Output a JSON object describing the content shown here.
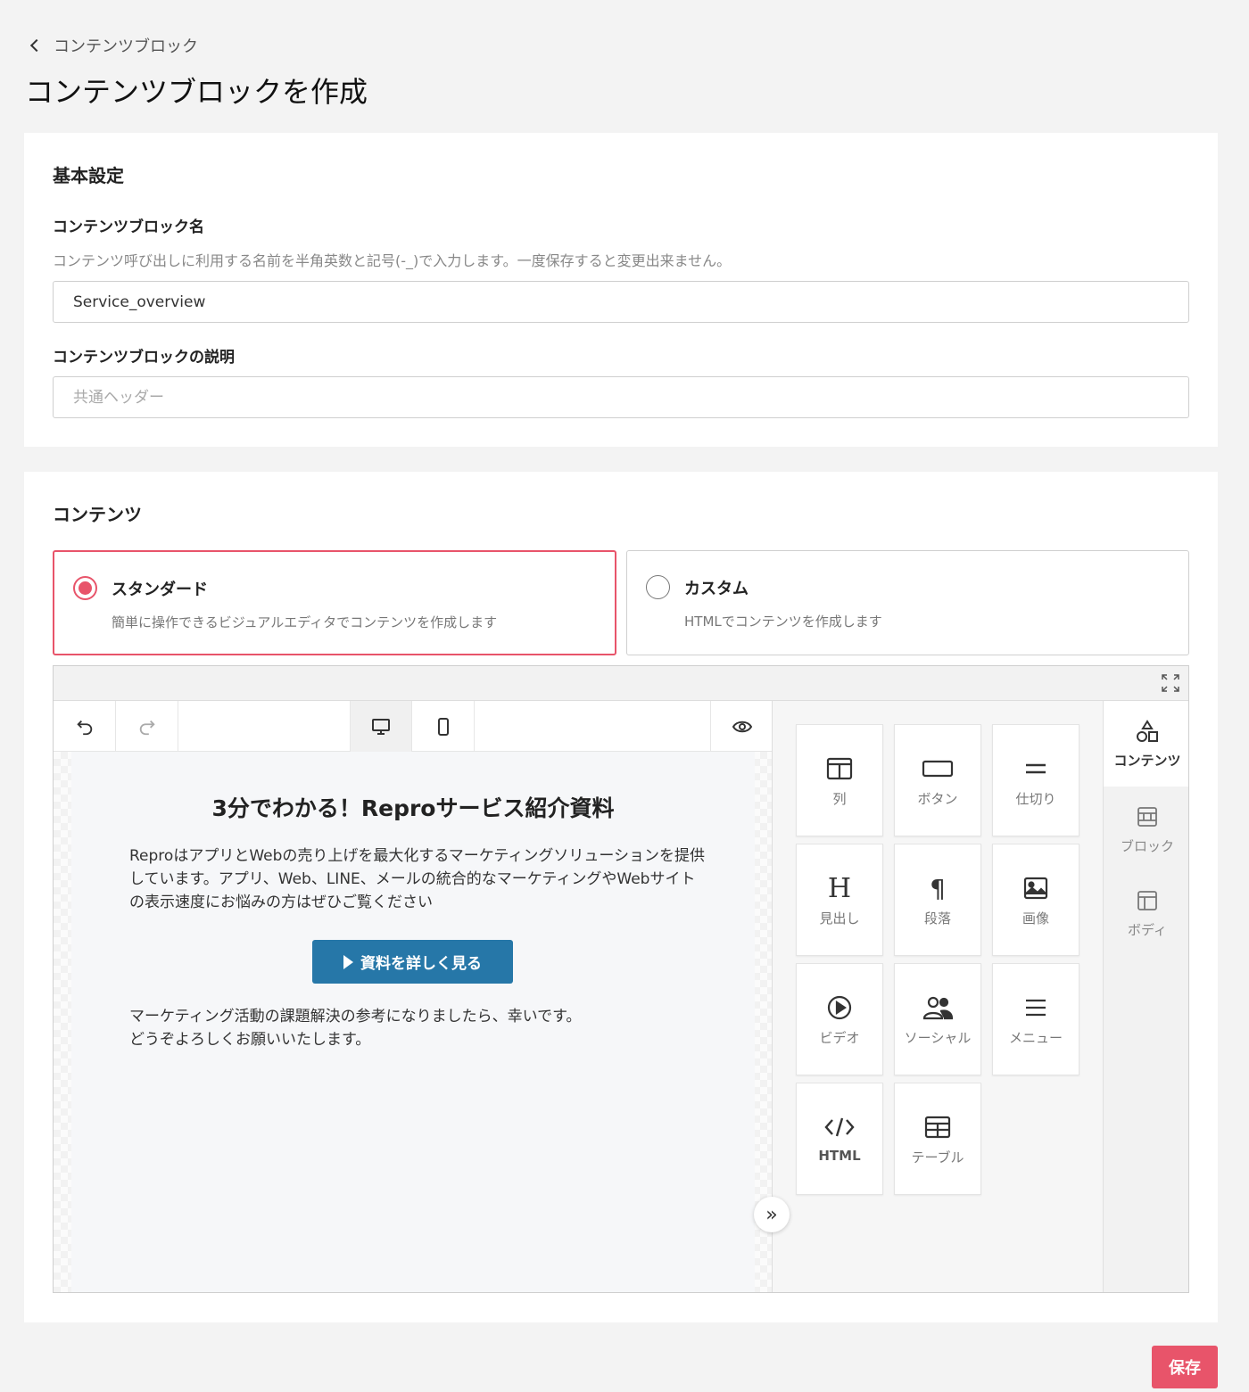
{
  "breadcrumb": {
    "label": "コンテンツブロック"
  },
  "page": {
    "title": "コンテンツブロックを作成"
  },
  "basic": {
    "title": "基本設定",
    "name_label": "コンテンツブロック名",
    "name_help": "コンテンツ呼び出しに利用する名前を半角英数と記号(-_)で入力します。一度保存すると変更出来ません。",
    "name_value": "Service_overview",
    "desc_label": "コンテンツブロックの説明",
    "desc_placeholder": "共通ヘッダー"
  },
  "contents": {
    "title": "コンテンツ",
    "options": [
      {
        "title": "スタンダード",
        "desc": "簡単に操作できるビジュアルエディタでコンテンツを作成します",
        "selected": true
      },
      {
        "title": "カスタム",
        "desc": "HTMLでコンテンツを作成します",
        "selected": false
      }
    ]
  },
  "editor": {
    "preview": {
      "title": "3分でわかる！Reproサービス紹介資料",
      "body": "ReproはアプリとWebの売り上げを最大化するマーケティングソリューションを提供しています。アプリ、Web、LINE、メールの統合的なマーケティングやWebサイトの表示速度にお悩みの方はぜひご覧ください",
      "button": "資料を詳しく見る",
      "footer_line1": "マーケティング活動の課題解決の参考になりましたら、幸いです。",
      "footer_line2": "どうぞよろしくお願いいたします。"
    },
    "tools": [
      {
        "label": "列",
        "icon": "columns-icon"
      },
      {
        "label": "ボタン",
        "icon": "button-icon"
      },
      {
        "label": "仕切り",
        "icon": "divider-icon"
      },
      {
        "label": "見出し",
        "icon": "heading-icon"
      },
      {
        "label": "段落",
        "icon": "paragraph-icon"
      },
      {
        "label": "画像",
        "icon": "image-icon"
      },
      {
        "label": "ビデオ",
        "icon": "video-icon"
      },
      {
        "label": "ソーシャル",
        "icon": "social-icon"
      },
      {
        "label": "メニュー",
        "icon": "menu-icon"
      },
      {
        "label": "HTML",
        "icon": "html-icon"
      },
      {
        "label": "テーブル",
        "icon": "table-icon"
      }
    ],
    "side_tabs": [
      {
        "label": "コンテンツ",
        "icon": "shapes-icon",
        "active": true
      },
      {
        "label": "ブロック",
        "icon": "blocks-icon",
        "active": false
      },
      {
        "label": "ボディ",
        "icon": "layout-icon",
        "active": false
      }
    ]
  },
  "save_button": "保存",
  "colors": {
    "accent": "#e8546a",
    "preview_button": "#2677a8"
  }
}
